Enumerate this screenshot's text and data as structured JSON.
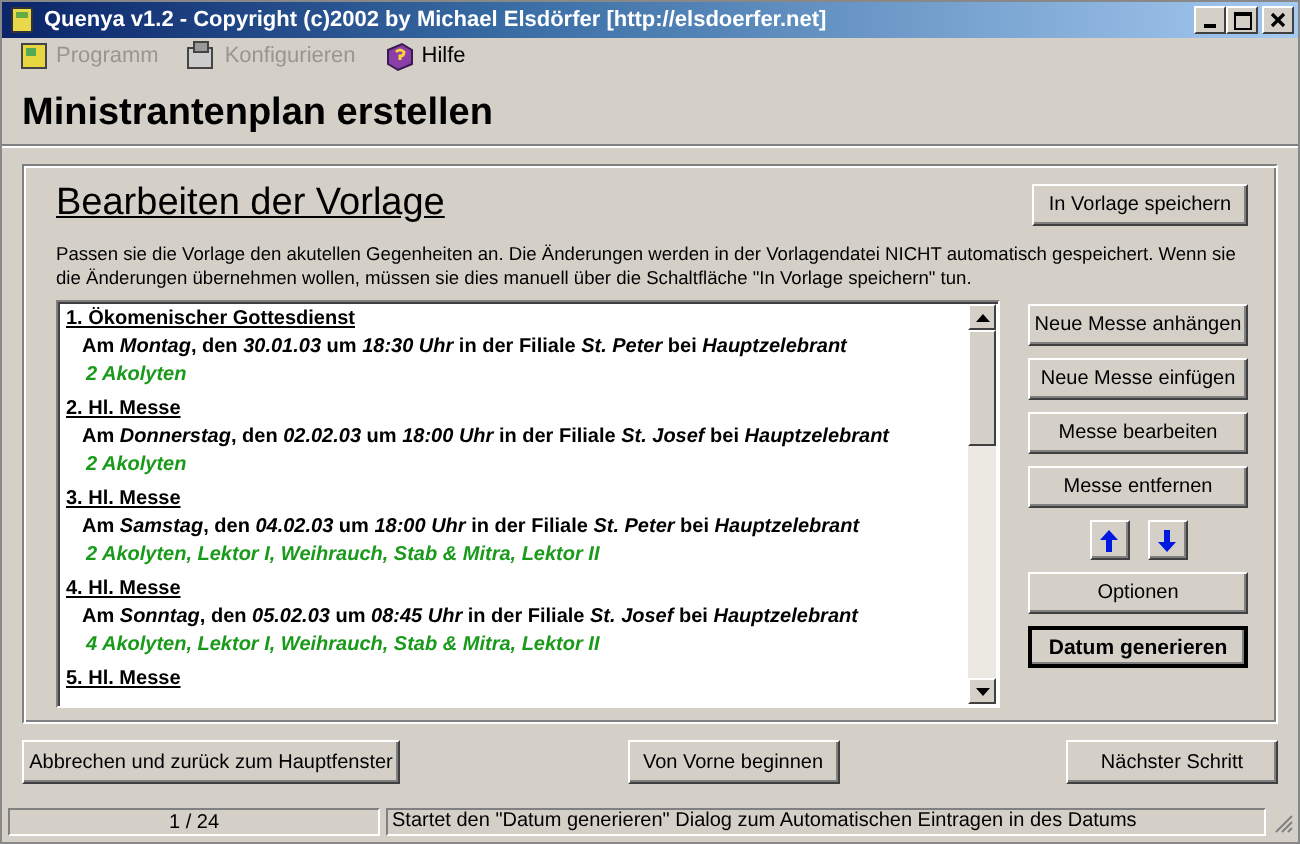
{
  "window": {
    "title": "Quenya v1.2  -  Copyright (c)2002 by Michael Elsdörfer [http://elsdoerfer.net]"
  },
  "menu": [
    {
      "label": "Programm",
      "disabled": true,
      "kind": "program"
    },
    {
      "label": "Konfigurieren",
      "disabled": true,
      "kind": "config"
    },
    {
      "label": "Hilfe",
      "disabled": false,
      "kind": "help"
    }
  ],
  "page_title": "Ministrantenplan erstellen",
  "panel": {
    "heading": "Bearbeiten der Vorlage",
    "save_button": "In Vorlage speichern",
    "description": "Passen sie die Vorlage den akutellen Gegenheiten an. Die Änderungen werden in der Vorlagendatei NICHT automatisch gespeichert. Wenn sie die Änderungen übernehmen wollen, müssen sie dies manuell über die Schaltfläche \"In Vorlage speichern\" tun.",
    "entries": [
      {
        "title": "1. Ökomenischer Gottesdienst",
        "details": "Am  *Montag*, den *30.01.03* um  *18:30 Uhr* in der Filiale  *St. Peter* bei *Hauptzelebrant*",
        "roles": "2 Akolyten"
      },
      {
        "title": "2. Hl. Messe",
        "details": "Am  *Donnerstag*, den *02.02.03* um  *18:00 Uhr* in der Filiale  *St. Josef* bei *Hauptzelebrant*",
        "roles": "2 Akolyten"
      },
      {
        "title": "3. Hl. Messe",
        "details": "Am  *Samstag*, den *04.02.03* um  *18:00 Uhr* in der Filiale  *St. Peter* bei *Hauptzelebrant*",
        "roles": "2 Akolyten, Lektor I, Weihrauch, Stab & Mitra, Lektor II"
      },
      {
        "title": "4. Hl. Messe",
        "details": "Am  *Sonntag*, den *05.02.03* um  *08:45 Uhr* in der Filiale  *St. Josef* bei *Hauptzelebrant*",
        "roles": "4 Akolyten, Lektor I, Weihrauch, Stab & Mitra, Lektor II"
      },
      {
        "title": "5. Hl. Messe"
      }
    ],
    "side_buttons": [
      {
        "label": "Neue Messe anhängen",
        "kind": "button",
        "default": false
      },
      {
        "label": "Neue Messe einfügen",
        "kind": "button",
        "default": false
      },
      {
        "label": "Messe bearbeiten",
        "kind": "button",
        "default": false
      },
      {
        "label": "Messe entfernen",
        "kind": "button",
        "default": false
      },
      {
        "kind": "arrows"
      },
      {
        "label": "Optionen",
        "kind": "button",
        "default": false
      },
      {
        "label": "Datum generieren",
        "kind": "button",
        "default": true
      }
    ]
  },
  "bottom_buttons": [
    "Abbrechen und zurück zum Hauptfenster",
    "Von Vorne beginnen",
    "Nächster Schritt"
  ],
  "status_bar": {
    "position": "1 / 24",
    "message": "Startet den \"Datum generieren\" Dialog zum Automatischen Eintragen in des Datums"
  }
}
